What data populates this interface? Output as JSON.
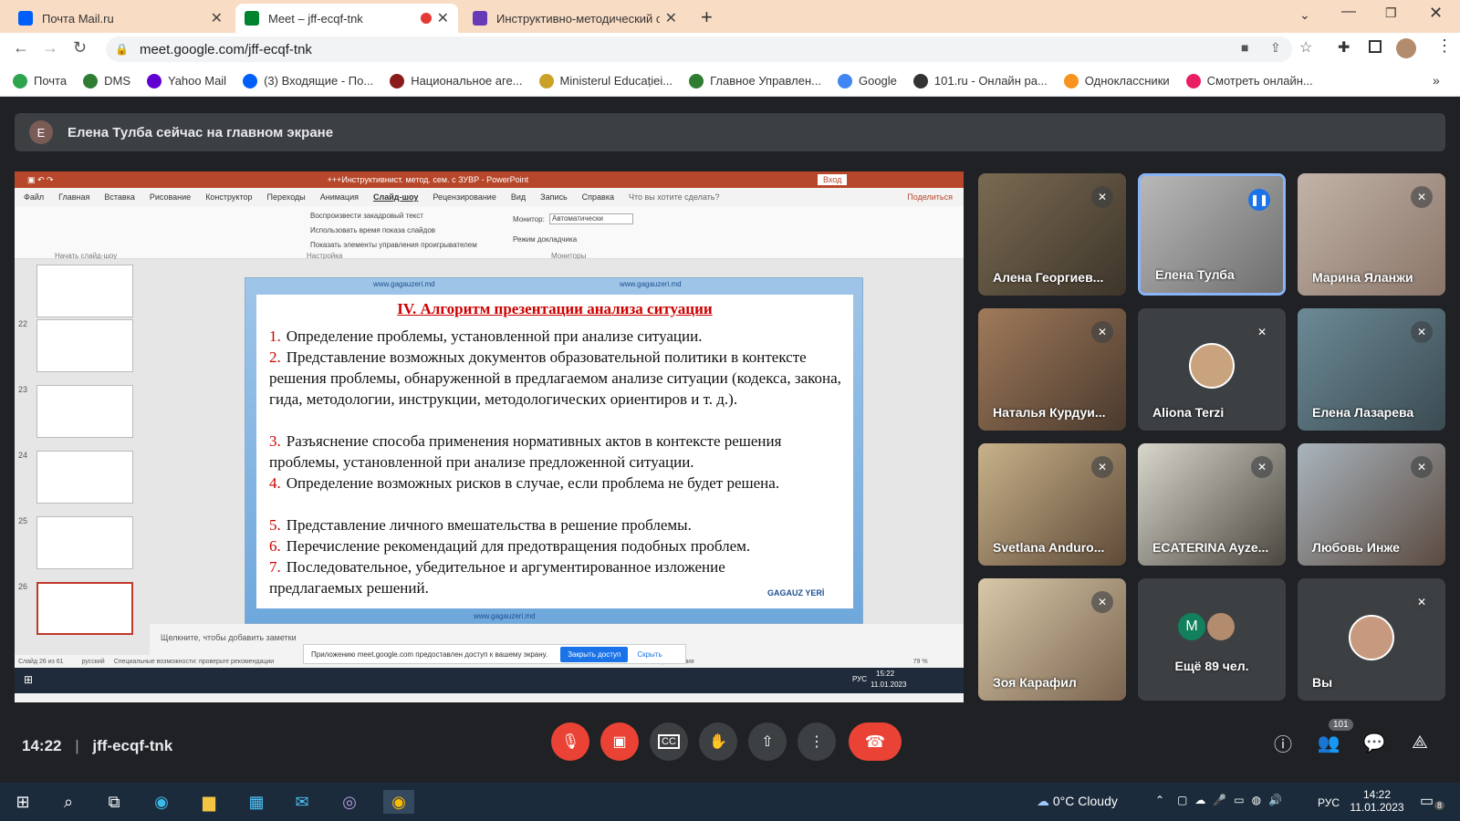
{
  "browser": {
    "tabs": [
      {
        "title": "Почта Mail.ru",
        "color": "#005ff9"
      },
      {
        "title": "Meet – jff-ecqf-tnk",
        "color": "#00832d"
      },
      {
        "title": "Инструктивно-методический се",
        "color": "#673ab7"
      }
    ],
    "url": "meet.google.com/jff-ecqf-tnk",
    "bookmarks": [
      {
        "label": "Почта",
        "color": "#2ea44f"
      },
      {
        "label": "DMS",
        "color": "#2e7d32"
      },
      {
        "label": "Yahoo Mail",
        "color": "#6001d2"
      },
      {
        "label": "(3) Входящие - По...",
        "color": "#005ff9"
      },
      {
        "label": "Национальное аге...",
        "color": "#8a1b1b"
      },
      {
        "label": "Ministerul Educației...",
        "color": "#c9a227"
      },
      {
        "label": "Главное Управлен...",
        "color": "#2e7d32"
      },
      {
        "label": "Google",
        "color": "#4285f4"
      },
      {
        "label": "101.ru - Онлайн ра...",
        "color": "#333333"
      },
      {
        "label": "Одноклассники",
        "color": "#f7931e"
      },
      {
        "label": "Смотреть онлайн...",
        "color": "#e91e63"
      }
    ]
  },
  "meet": {
    "banner_initial": "E",
    "banner_text": "Елена Тулба сейчас на главном экране",
    "time": "14:22",
    "code": "jff-ecqf-tnk",
    "people_count": "101",
    "participants": [
      {
        "name": "Алена Георгиев...",
        "muted": true
      },
      {
        "name": "Елена Тулба",
        "muted": false
      },
      {
        "name": "Марина Яланжи",
        "muted": true
      },
      {
        "name": "Наталья Курдуи...",
        "muted": true
      },
      {
        "name": "Aliona Terzi",
        "muted": true
      },
      {
        "name": "Елена Лазарева",
        "muted": true
      },
      {
        "name": "Svetlana Anduro...",
        "muted": true
      },
      {
        "name": "ECATERINA Ayze...",
        "muted": true
      },
      {
        "name": "Любовь Инже",
        "muted": true
      },
      {
        "name": "Зоя Карафил",
        "muted": true
      },
      {
        "name": "Ещё 89 чел.",
        "muted": false
      },
      {
        "name": "Вы",
        "muted": true
      }
    ],
    "more_initial": "M"
  },
  "ppt": {
    "title": "+++Инструктивнист. метод. сем. с ЗУВР - PowerPoint",
    "login": "Вход",
    "menu": [
      "Файл",
      "Главная",
      "Вставка",
      "Рисование",
      "Конструктор",
      "Переходы",
      "Анимация",
      "Слайд-шоу",
      "Рецензирование",
      "Вид",
      "Запись",
      "Справка",
      "Что вы хотите сделать?"
    ],
    "share": "Поделиться",
    "ribbon_checks": [
      "Воспроизвести закадровый текст",
      "Использовать время показа слайдов",
      "Показать элементы управления проигрывателем"
    ],
    "ribbon_groups": [
      "Начать слайд-шоу",
      "Настройка",
      "Мониторы"
    ],
    "monitor_label": "Монитор:",
    "monitor_value": "Автоматически",
    "presenter_mode": "Режим докладчика",
    "thumb_numbers": [
      "22",
      "23",
      "24",
      "25",
      "26"
    ],
    "slide_header": "www.gagauzeri.md",
    "slide_title": "IV. Алгоритм презентации анализа ситуации",
    "items": [
      "Определение проблемы, установленной при анализе ситуации.",
      "Представление возможных документов образовательной политики в контексте решения проблемы, обнаруженной в предлагаемом анализе ситуации (кодекса, закона, гида, методологии, инструкции, методологических ориентиров и т. д.).",
      "Разъяснение способа применения нормативных актов в контексте решения проблемы, установленной при анализе предложенной ситуации.",
      "Определение возможных рисков в случае, если проблема не будет решена.",
      "Представление личного вмешательства в решение проблемы.",
      "Перечисление рекомендаций для предотвращения подобных проблем.",
      "Последовательное, убедительное и аргументированное изложение предлагаемых решений."
    ],
    "logo_text": "GAGAUZ YERİ",
    "notes": "Щелкните, чтобы добавить заметки",
    "status_left": "Слайд 26 из 61",
    "status_lang": "русский",
    "status_access": "Специальные возможности: проверьте рекомендации",
    "status_notes": "Примечания",
    "zoom": "79 %",
    "share_notice": "Приложению meet.google.com предоставлен доступ к вашему экрану.",
    "stop_share": "Закрыть доступ",
    "hide": "Скрыть",
    "inner_clock_time": "15:22",
    "inner_clock_date": "11.01.2023",
    "inner_lang": "РУС"
  },
  "taskbar": {
    "weather": "0°C Cloudy",
    "lang": "РУС",
    "time": "14:22",
    "date": "11.01.2023",
    "notif_count": "8"
  }
}
